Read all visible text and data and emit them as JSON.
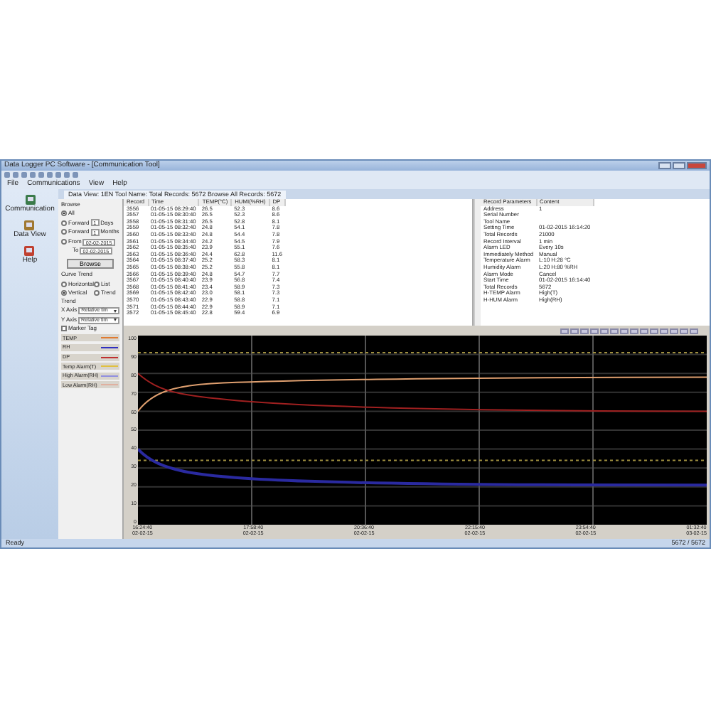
{
  "window": {
    "title": "Data Logger PC Software - [Communication Tool]"
  },
  "menu": [
    "File",
    "Communications",
    "View",
    "Help"
  ],
  "nav": [
    "Communication",
    "Data View",
    "Help"
  ],
  "tab": {
    "label": "Data View: 1EN   Tool Name:    Total Records: 5672  Browse All Records: 5672"
  },
  "browse": {
    "title": "Browse",
    "options": [
      {
        "label": "All",
        "selected": true
      },
      {
        "label": "Forward",
        "value": "1",
        "unit": "Days",
        "selected": false
      },
      {
        "label": "Forward",
        "value": "1",
        "unit": "Months",
        "selected": false
      },
      {
        "label": "From",
        "value": "02-02-2015",
        "selected": false
      }
    ],
    "to": {
      "label": "To",
      "value": "02-02-2015"
    },
    "button": "Browse"
  },
  "curve": {
    "title": "Curve Trend",
    "options": [
      {
        "label": "Horizontal",
        "selected": false
      },
      {
        "label": "List",
        "selected": false
      },
      {
        "label": "Vertical",
        "selected": true
      },
      {
        "label": "Trend",
        "selected": false
      }
    ],
    "trend_label": "Trend"
  },
  "axes": [
    {
      "label": "X Axis",
      "value": "Relative tim"
    },
    {
      "label": "Y Axis",
      "value": "Relative tim"
    }
  ],
  "marker": {
    "label": "Marker Tag",
    "checked": false
  },
  "legend": [
    {
      "label": "TEMP",
      "color": "#e07a30"
    },
    {
      "label": "RH",
      "color": "#3030c0"
    },
    {
      "label": "DP",
      "color": "#c03030"
    },
    {
      "label": "Temp Alarm(T)",
      "color": "#e0c040"
    },
    {
      "label": "High Alarm(RH)",
      "color": "#9090e0"
    },
    {
      "label": "Low Alarm(RH)",
      "color": "#e0b0a0"
    }
  ],
  "records": {
    "columns": [
      "Record",
      "Time",
      "TEMP(°C)",
      "HUMI(%RH)",
      "DP"
    ],
    "rows": [
      [
        "3556",
        "01-05-15 08:29:40",
        "26.5",
        "52.3",
        "8.6"
      ],
      [
        "3557",
        "01-05-15 08:30:40",
        "26.5",
        "52.3",
        "8.6"
      ],
      [
        "3558",
        "01-05-15 08:31:40",
        "26.5",
        "52.8",
        "8.1"
      ],
      [
        "3559",
        "01-05-15 08:32:40",
        "24.8",
        "54.1",
        "7.8"
      ],
      [
        "3560",
        "01-05-15 08:33:40",
        "24.8",
        "54.4",
        "7.8"
      ],
      [
        "3561",
        "01-05-15 08:34:40",
        "24.2",
        "54.5",
        "7.9"
      ],
      [
        "3562",
        "01-05-15 08:35:40",
        "23.9",
        "55.1",
        "7.6"
      ],
      [
        "3563",
        "01-05-15 08:36:40",
        "24.4",
        "62.8",
        "11.6"
      ],
      [
        "3564",
        "01-05-15 08:37:40",
        "25.2",
        "58.3",
        "8.1"
      ],
      [
        "3565",
        "01-05-15 08:38:40",
        "25.2",
        "55.8",
        "8.1"
      ],
      [
        "3566",
        "01-05-15 08:39:40",
        "24.8",
        "54.7",
        "7.7"
      ],
      [
        "3567",
        "01-05-15 08:40:40",
        "23.9",
        "56.8",
        "7.4"
      ],
      [
        "3568",
        "01-05-15 08:41:40",
        "23.4",
        "58.9",
        "7.3"
      ],
      [
        "3569",
        "01-05-15 08:42:40",
        "23.0",
        "58.1",
        "7.3"
      ],
      [
        "3570",
        "01-05-15 08:43:40",
        "22.9",
        "58.8",
        "7.1"
      ],
      [
        "3571",
        "01-05-15 08:44:40",
        "22.9",
        "58.9",
        "7.1"
      ],
      [
        "3572",
        "01-05-15 08:45:40",
        "22.8",
        "59.4",
        "6.9"
      ]
    ]
  },
  "params": {
    "columns": [
      "Record Parameters",
      "Content"
    ],
    "rows": [
      [
        "Address",
        "1"
      ],
      [
        "Serial Number",
        ""
      ],
      [
        "Tool Name",
        ""
      ],
      [
        "Setting Time",
        "01-02-2015 16:14:20"
      ],
      [
        "Total Records",
        "21000"
      ],
      [
        "Record Interval",
        "1 min"
      ],
      [
        "Alarm LED",
        "Every 10s"
      ],
      [
        "Immediately Method",
        "Manual"
      ],
      [
        "Temperature Alarm",
        "L:10 H:28 °C"
      ],
      [
        "Humidity Alarm",
        "L:20 H:80 %RH"
      ],
      [
        "Alarm Mode",
        "Cancel"
      ],
      [
        "Start Time",
        "01-02-2015 16:14:40"
      ],
      [
        "Total Records",
        "5672"
      ],
      [
        "H-TEMP Alarm",
        "High(T)"
      ],
      [
        "H-HUM Alarm",
        "High(RH)"
      ]
    ]
  },
  "chart": {
    "y_labels": [
      "100",
      "90",
      "80",
      "70",
      "60",
      "50",
      "40",
      "30",
      "20",
      "10",
      "0"
    ],
    "x_labels": [
      [
        "16:24:40",
        "02-02-15"
      ],
      [
        "17:58:40",
        "02-02-15"
      ],
      [
        "20:36:40",
        "02-02-15"
      ],
      [
        "22:15:40",
        "02-02-15"
      ],
      [
        "23:54:40",
        "02-02-15"
      ],
      [
        "01:32:40",
        "03-02-15"
      ]
    ]
  },
  "status": {
    "left": "Ready",
    "right": "5672 / 5672"
  }
}
